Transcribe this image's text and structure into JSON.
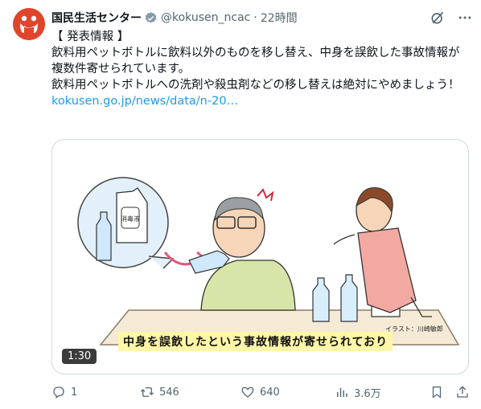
{
  "post": {
    "display_name": "国民生活センター",
    "handle": "@kokusen_ncac",
    "separator": "·",
    "time": "22時間",
    "lines": [
      "【 発表情報 】",
      "飲料用ペットボトルに飲料以外のものを移し替え、中身を誤飲した事故情報が複数件寄せられています。",
      "飲料用ペットボトルへの洗剤や殺虫剤などの移し替えは絶対にやめましょう！"
    ],
    "link_text": "kokusen.go.jp/news/data/n-20…"
  },
  "media": {
    "duration": "1:30",
    "caption": "中身を誤飲したという事故情報が寄せられており",
    "credit": "イラスト：川崎敏郎",
    "bottle_label": "消毒液"
  },
  "actions": {
    "replies": "1",
    "reposts": "546",
    "likes": "640",
    "views": "3.6万"
  },
  "colors": {
    "accent": "#1d9bf0",
    "brand": "#e0452c"
  }
}
